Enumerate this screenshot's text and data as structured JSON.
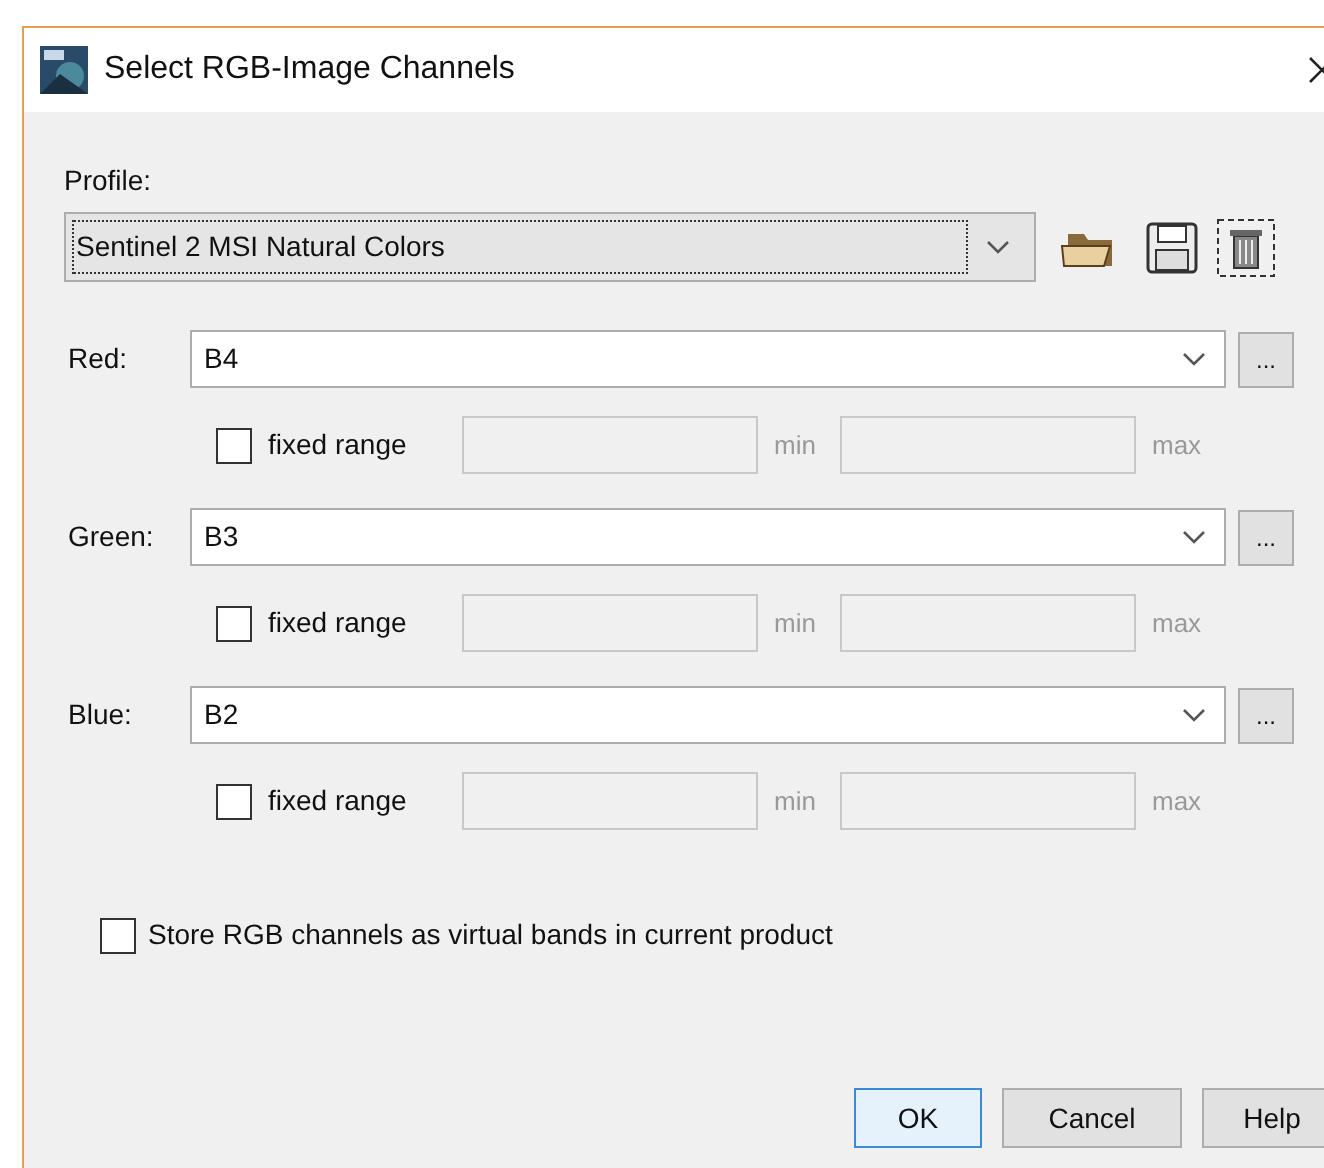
{
  "window": {
    "title": "Select RGB-Image Channels"
  },
  "profile": {
    "label": "Profile:",
    "value": "Sentinel 2 MSI Natural Colors"
  },
  "channels": [
    {
      "label": "Red:",
      "value": "B4",
      "fixed_range": {
        "label": "fixed range",
        "checked": false
      },
      "min_label": "min",
      "max_label": "max",
      "more": "..."
    },
    {
      "label": "Green:",
      "value": "B3",
      "fixed_range": {
        "label": "fixed range",
        "checked": false
      },
      "min_label": "min",
      "max_label": "max",
      "more": "..."
    },
    {
      "label": "Blue:",
      "value": "B2",
      "fixed_range": {
        "label": "fixed range",
        "checked": false
      },
      "min_label": "min",
      "max_label": "max",
      "more": "..."
    }
  ],
  "store_virtual": {
    "label": "Store RGB channels as virtual bands in current product",
    "checked": false
  },
  "buttons": [
    {
      "label": "OK",
      "focused": true
    },
    {
      "label": "Cancel",
      "focused": false
    },
    {
      "label": "Help",
      "focused": false
    }
  ]
}
